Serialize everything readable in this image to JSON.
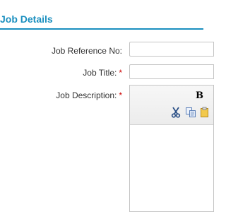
{
  "section": {
    "title": "Job Details"
  },
  "form": {
    "job_reference": {
      "label": "Job Reference No:",
      "value": ""
    },
    "job_title": {
      "label": "Job Title:",
      "required_mark": "*",
      "value": ""
    },
    "job_description": {
      "label": "Job Description:",
      "required_mark": "*"
    }
  },
  "editor": {
    "bold_label": "B",
    "toolbar_icons": [
      "cut-icon",
      "copy-icon",
      "paste-icon"
    ]
  },
  "colors": {
    "accent": "#1a8fbf",
    "required": "#cc0000"
  }
}
